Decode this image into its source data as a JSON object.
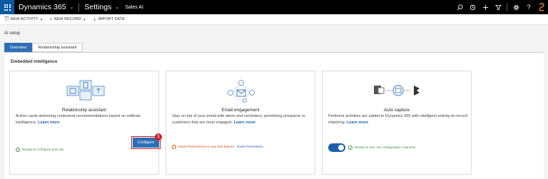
{
  "topbar": {
    "brand": "Dynamics 365",
    "area": "Settings",
    "crumb": "Sales AI",
    "icons": [
      "search-icon",
      "history-icon",
      "plus-icon",
      "filter-icon",
      "settings-icon",
      "help-icon",
      "user-icon"
    ]
  },
  "commands": {
    "new_activity": "NEW ACTIVITY",
    "new_record": "NEW RECORD",
    "import_data": "IMPORT DATA"
  },
  "page_title": "AI setup",
  "tabs": {
    "overview": "Overview",
    "relationship": "Relationship assistant"
  },
  "section_title": "Embedded intelligence",
  "cards": {
    "relationship": {
      "title": "Relationship assistant",
      "desc": "Action cards delivering contextual recommendations based on artificial intelligence.",
      "learn": "Learn more",
      "status": "Ready to configure and use",
      "button": "Configure",
      "badge": "1"
    },
    "email": {
      "title": "Email engagement",
      "desc": "Stay on top of your email with alerts and reminders, prioritizing prospects or customers that are most engaged.",
      "learn": "Learn more",
      "status": "Need Permissions to use this feature.",
      "grant": "Grant Permission"
    },
    "auto": {
      "title": "Auto capture",
      "desc": "Pertinent activities are added to Dynamics 365 with intelligent activity-to-record matching.",
      "learn": "Learn more",
      "status": "Ready to use. No configuration required."
    }
  },
  "colors": {
    "accent": "#2f6fb6",
    "brand_tile": "#0b5aa5",
    "ok": "#3a8f3a",
    "warn": "#d0541b",
    "callout": "#d41f1f"
  }
}
